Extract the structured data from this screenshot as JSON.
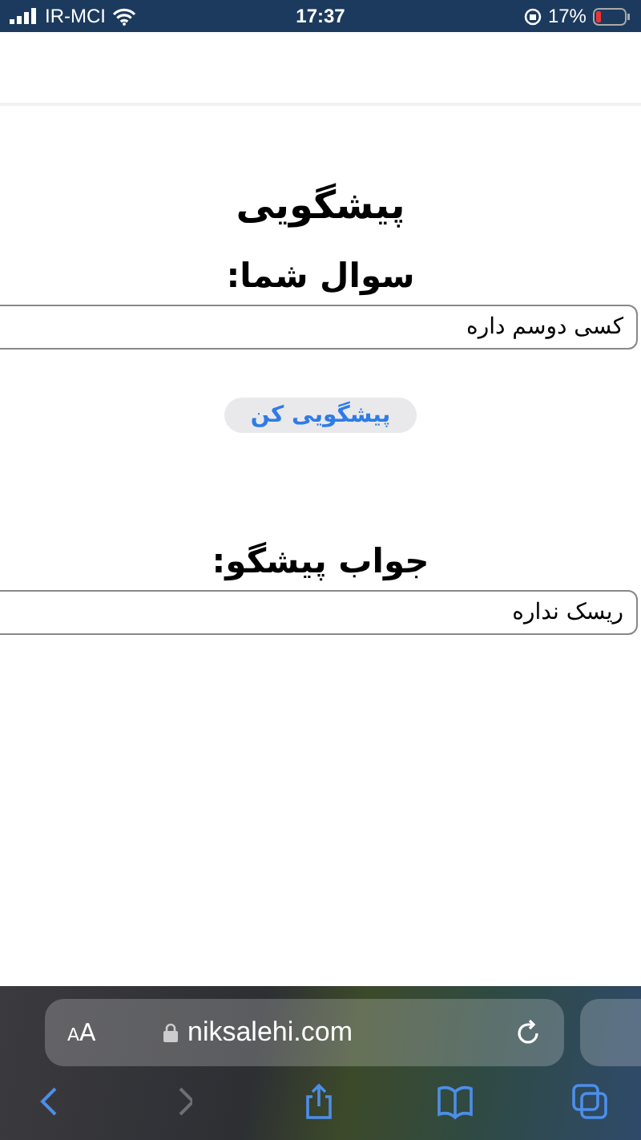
{
  "status_bar": {
    "carrier": "IR-MCI",
    "time": "17:37",
    "battery": "17%"
  },
  "page": {
    "title": "پیشگویی",
    "question_label": "سوال شما:",
    "question_value": "کسی دوسم داره",
    "button": "پیشگویی کن",
    "answer_label": "جواب پیشگو:",
    "answer_value": "ریسک نداره"
  },
  "browser": {
    "text_size": "AA",
    "url": "niksalehi.com",
    "nav": [
      {
        "kind": "back",
        "disabled": false
      },
      {
        "kind": "forward",
        "disabled": true
      },
      {
        "kind": "share",
        "disabled": false
      },
      {
        "kind": "bookmarks",
        "disabled": false
      },
      {
        "kind": "tabs",
        "disabled": false
      }
    ]
  }
}
